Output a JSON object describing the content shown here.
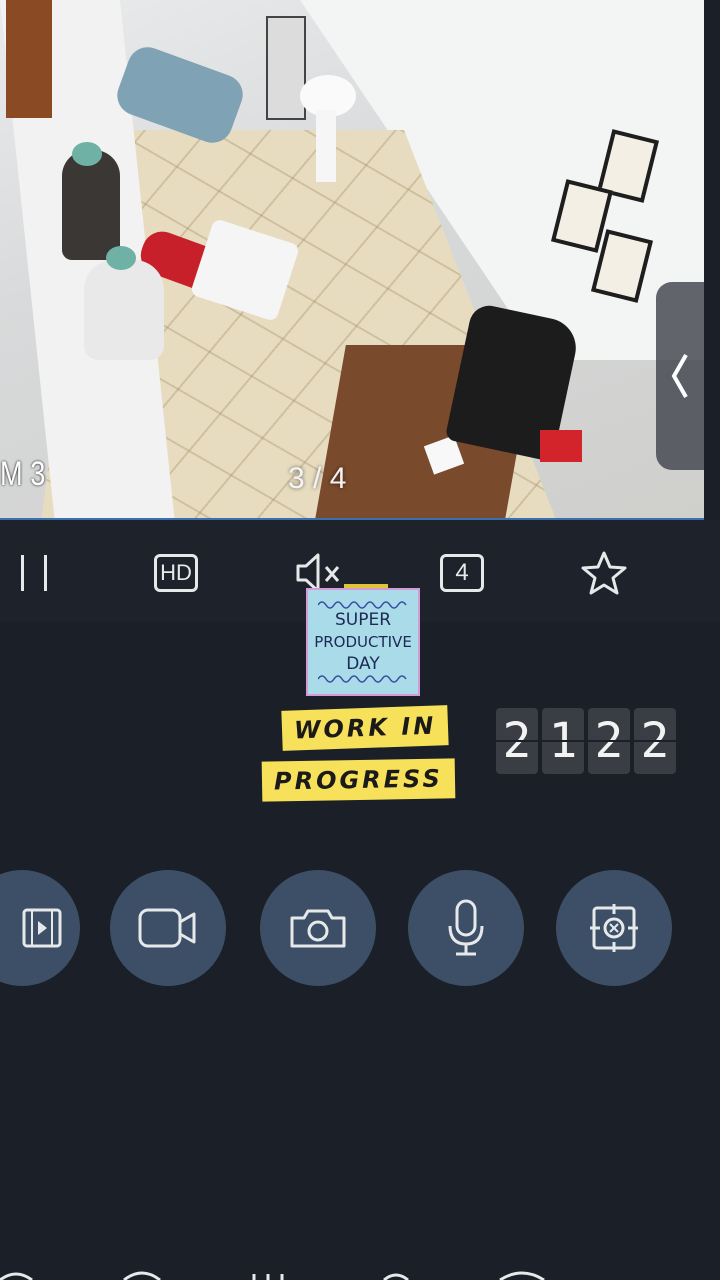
{
  "camera": {
    "channel_label": "M 3",
    "page_indicator": "3 / 4"
  },
  "controls": {
    "pause_icon": "pause-icon",
    "hd_label": "HD",
    "mute_icon": "speaker-muted-icon",
    "split_label": "4",
    "favorite_icon": "star-icon"
  },
  "stickers": {
    "note_lines": [
      "SUPER",
      "PRODUCTIVE",
      "DAY"
    ],
    "wip_line1": "WORK IN",
    "wip_line2": "PROGRESS",
    "clock_digits": [
      "2",
      "1",
      "2",
      "2"
    ]
  },
  "actions": [
    {
      "icon": "video-playback-icon"
    },
    {
      "icon": "video-record-icon"
    },
    {
      "icon": "camera-snapshot-icon"
    },
    {
      "icon": "microphone-icon"
    },
    {
      "icon": "ptz-target-icon"
    }
  ],
  "colors": {
    "background": "#1b1f27",
    "action_button": "#3d4f66",
    "accent_border": "#3a6fb0",
    "sticker_yellow": "#f7e15a"
  }
}
